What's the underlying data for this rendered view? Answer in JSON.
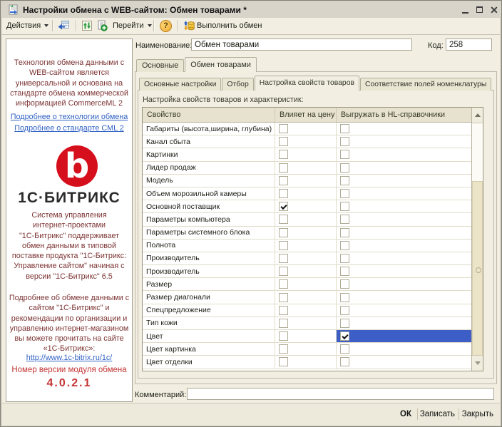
{
  "window": {
    "title": "Настройки обмена с WEB-сайтом: Обмен товарами *",
    "icons": {
      "app": "exchange-document-icon",
      "minimize": "minimize-icon",
      "maximize": "maximize-icon",
      "close": "close-icon"
    }
  },
  "toolbar": {
    "actions_label": "Действия",
    "goto_label": "Перейти",
    "run_label": "Выполнить обмен",
    "icons": [
      "reread-icon",
      "refresh-icon",
      "copy-add-icon",
      "help-icon",
      "run-exchange-icon"
    ]
  },
  "sidebar": {
    "para1": "Технология обмена данными с\nWEB-сайтом является\nуниверсальной и основана на\nстандарте обмена коммерческой\nинформацией CommerceML 2",
    "link_tech": "Подробнее о технологии обмена",
    "link_cml": "Подробнее о стандарте CML 2",
    "logo_text": "1С·БИТРИКС",
    "para2": "Система управления\nинтернет-проектами\n\"1С-Битрикс\" поддерживает\nобмен данными в типовой\nпоставке продукта \"1С-Битрикс:\nУправление сайтом\" начиная с\nверсии \"1С-Битрикс\" 6.5",
    "para3": "Подробнее об обмене данными с\nсайтом \"1С-Битрикс\" и\nрекомендации по организации и\nуправлению интернет-магазином\nвы можете прочитать на сайте\n«1С-Битрикс»:",
    "link_url": "http://www.1c-bitrix.ru/1c/",
    "version_label": "Номер версии модуля обмена",
    "version": "4.0.2.1"
  },
  "form": {
    "name_label": "Наименование:",
    "name_value": "Обмен товарами",
    "code_label": "Код:",
    "code_value": "258",
    "comment_label": "Комментарий:",
    "comment_value": ""
  },
  "tabs": {
    "outer": [
      "Основные",
      "Обмен товарами"
    ],
    "outer_active_index": 1,
    "inner": [
      "Основные настройки",
      "Отбор",
      "Настройка свойств товаров",
      "Соответствие полей номенклатуры"
    ],
    "inner_active_index": 2
  },
  "table": {
    "caption": "Настройка свойств товаров и характеристик:",
    "columns": [
      "Свойство",
      "Влияет на цену",
      "Выгружать в HL-справочники"
    ],
    "rows": [
      {
        "name": "Габариты (высота,ширина, глубина)",
        "affects_price": false,
        "export_hl": false
      },
      {
        "name": "Канал сбыта",
        "affects_price": false,
        "export_hl": false
      },
      {
        "name": "Картинки",
        "affects_price": false,
        "export_hl": false
      },
      {
        "name": "Лидер продаж",
        "affects_price": false,
        "export_hl": false
      },
      {
        "name": "Модель",
        "affects_price": false,
        "export_hl": false
      },
      {
        "name": "Объем морозильной камеры",
        "affects_price": false,
        "export_hl": false
      },
      {
        "name": "Основной поставщик",
        "affects_price": true,
        "export_hl": false
      },
      {
        "name": "Параметры компьютера",
        "affects_price": false,
        "export_hl": false
      },
      {
        "name": "Параметры системного блока",
        "affects_price": false,
        "export_hl": false
      },
      {
        "name": "Полнота",
        "affects_price": false,
        "export_hl": false
      },
      {
        "name": "Производитель",
        "affects_price": false,
        "export_hl": false
      },
      {
        "name": "Производитель",
        "affects_price": false,
        "export_hl": false
      },
      {
        "name": "Размер",
        "affects_price": false,
        "export_hl": false
      },
      {
        "name": "Размер диагонали",
        "affects_price": false,
        "export_hl": false
      },
      {
        "name": "Спецпредложение",
        "affects_price": false,
        "export_hl": false
      },
      {
        "name": "Тип кожи",
        "affects_price": false,
        "export_hl": false
      },
      {
        "name": "Цвет",
        "affects_price": false,
        "export_hl": true,
        "selected": true
      },
      {
        "name": "Цвет картинка",
        "affects_price": false,
        "export_hl": false
      },
      {
        "name": "Цвет отделки",
        "affects_price": false,
        "export_hl": false
      }
    ]
  },
  "footer": {
    "ok": "ОК",
    "save": "Записать",
    "close": "Закрыть"
  },
  "colors": {
    "selection": "#3d5ec6",
    "logo_red": "#d5101c",
    "sidebar_maroon": "#7d3434",
    "version_red": "#c43434",
    "link_blue": "#3162c4",
    "client_bg": "#f2efe2"
  }
}
